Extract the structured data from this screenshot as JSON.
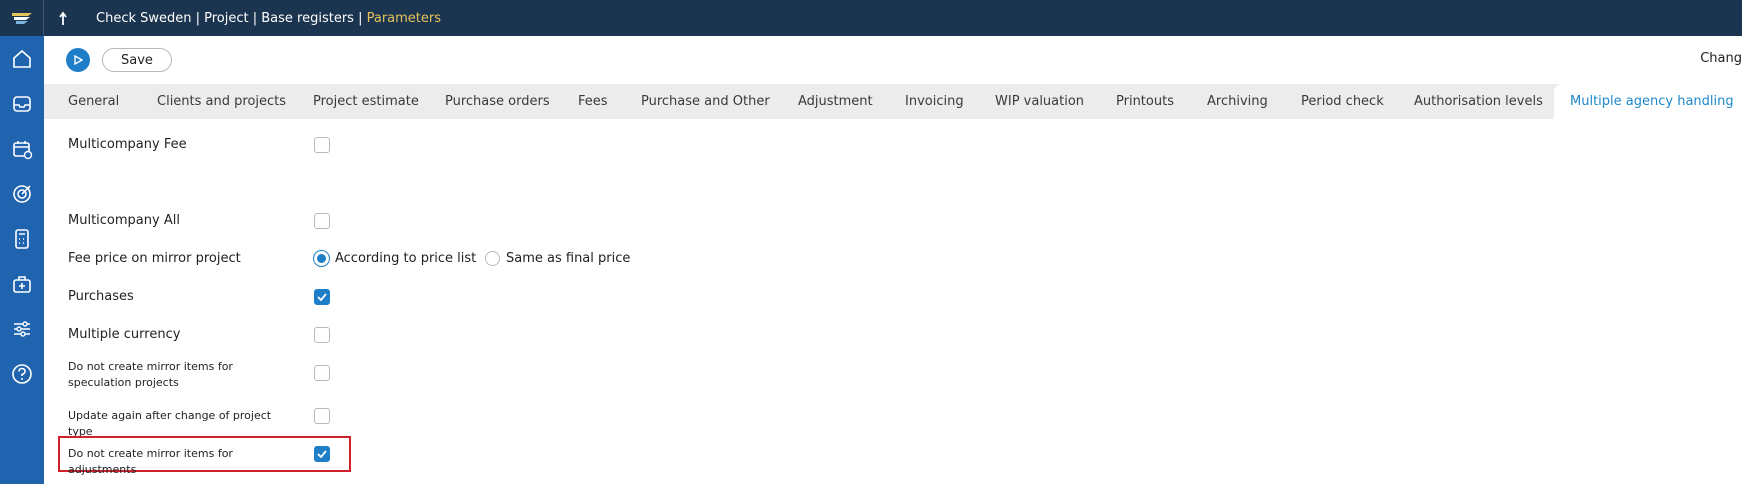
{
  "header": {
    "breadcrumb": "Check Sweden | Project | Base registers |",
    "breadcrumb_active": "Parameters"
  },
  "sidebar": {
    "icons": [
      "home-icon",
      "inbox-icon",
      "calendar-icon",
      "target-icon",
      "calculator-icon",
      "toolbox-icon",
      "sliders-icon",
      "help-icon"
    ]
  },
  "toolbar": {
    "save_label": "Save",
    "change_label": "Change"
  },
  "tabs": [
    {
      "label": "General"
    },
    {
      "label": "Clients and projects"
    },
    {
      "label": "Project estimate"
    },
    {
      "label": "Purchase orders"
    },
    {
      "label": "Fees"
    },
    {
      "label": "Purchase and Other"
    },
    {
      "label": "Adjustment"
    },
    {
      "label": "Invoicing"
    },
    {
      "label": "WIP valuation"
    },
    {
      "label": "Printouts"
    },
    {
      "label": "Archiving"
    },
    {
      "label": "Period check"
    },
    {
      "label": "Authorisation levels"
    },
    {
      "label": "Multiple agency handling",
      "active": true
    }
  ],
  "fields": {
    "multicompany_fee": {
      "label": "Multicompany Fee",
      "checked": false
    },
    "multicompany_all": {
      "label": "Multicompany All",
      "checked": false
    },
    "fee_price": {
      "label": "Fee price on mirror project",
      "options": [
        "According to price list",
        "Same as final price"
      ],
      "selected": "According to price list"
    },
    "purchases": {
      "label": "Purchases",
      "checked": true
    },
    "multiple_currency": {
      "label": "Multiple currency",
      "checked": false
    },
    "no_mirror_speculation": {
      "label": "Do not create mirror items for speculation projects",
      "checked": false
    },
    "update_again": {
      "label": "Update again after change of project type",
      "checked": false
    },
    "no_mirror_adjustments": {
      "label": "Do not create mirror items for adjustments",
      "checked": true
    }
  },
  "colors": {
    "topbar": "#1b3550",
    "sidebar": "#2064b0",
    "accent": "#1e7fc8",
    "breadcrumb_active": "#e7c35a",
    "highlight": "#d0202a"
  }
}
